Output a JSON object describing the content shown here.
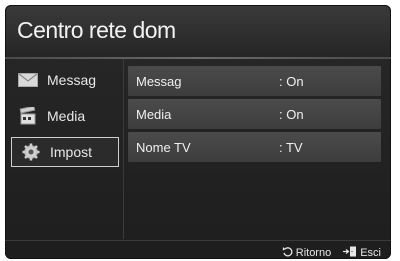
{
  "header": {
    "title": "Centro rete dom"
  },
  "sidebar": {
    "items": [
      {
        "label": "Messag",
        "icon": "mail-icon",
        "selected": false
      },
      {
        "label": "Media",
        "icon": "film-clapper-icon",
        "selected": false
      },
      {
        "label": "Impost",
        "icon": "gear-icon",
        "selected": true
      }
    ]
  },
  "settings": {
    "rows": [
      {
        "label": "Messag",
        "value": ": On"
      },
      {
        "label": "Media",
        "value": ": On"
      },
      {
        "label": "Nome TV",
        "value": ": TV"
      }
    ]
  },
  "footer": {
    "back_label": "Ritorno",
    "back_icon": "return-arrow-icon",
    "exit_label": "Esci",
    "exit_icon": "exit-door-icon"
  }
}
